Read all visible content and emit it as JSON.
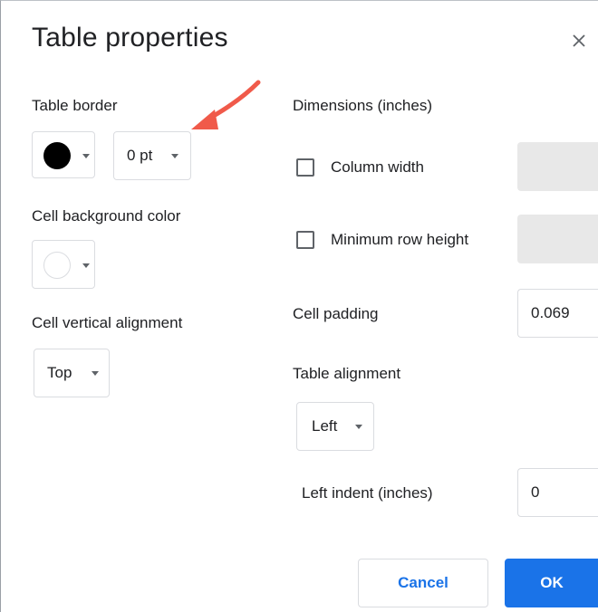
{
  "dialog": {
    "title": "Table properties",
    "close_icon": "close-icon"
  },
  "table_border": {
    "label": "Table border",
    "color": "#000000",
    "width_value": "0 pt"
  },
  "cell_background": {
    "label": "Cell background color",
    "color": "#ffffff"
  },
  "cell_vertical_alignment": {
    "label": "Cell vertical alignment",
    "value": "Top"
  },
  "dimensions": {
    "label": "Dimensions  (inches)",
    "column_width_label": "Column width",
    "column_width_checked": false,
    "min_row_height_label": "Minimum row height",
    "min_row_height_checked": false
  },
  "cell_padding": {
    "label": "Cell padding",
    "value": "0.069"
  },
  "table_alignment": {
    "label": "Table alignment",
    "value": "Left",
    "left_indent_label": "Left indent  (inches)",
    "left_indent_value": "0"
  },
  "buttons": {
    "cancel": "Cancel",
    "ok": "OK"
  },
  "colors": {
    "accent": "#1a73e8",
    "annotation_arrow": "#f05a4a"
  }
}
